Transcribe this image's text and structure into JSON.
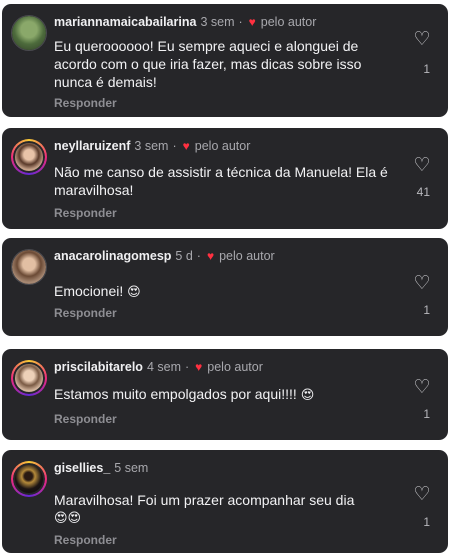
{
  "comments": [
    {
      "user": "mariannamaicabailarina",
      "time": "3 sem",
      "author_tag": "pelo autor",
      "text": "Eu queroooooo! Eu sempre aqueci e alonguei de acordo com o que iria fazer, mas dicas sobre isso nunca é demais!",
      "reply": "Responder",
      "likes": "1",
      "avatar_icon": "profile-photo-plant"
    },
    {
      "user": "neyllaruizenf",
      "time": "3 sem",
      "author_tag": "pelo autor",
      "text": "Não me canso de assistir a técnica da Manuela! Ela é maravilhosa!",
      "reply": "Responder",
      "likes": "41",
      "avatar_icon": "profile-photo-woman"
    },
    {
      "user": "anacarolinagomesp",
      "time": "5 d",
      "author_tag": "pelo autor",
      "text": "Emocionei!",
      "emoji": "😍",
      "reply": "Responder",
      "likes": "1",
      "avatar_icon": "profile-photo-woman"
    },
    {
      "user": "priscilabitarelo",
      "time": "4 sem",
      "author_tag": "pelo autor",
      "text": "Estamos muito empolgados por aqui!!!!",
      "emoji": "😍",
      "reply": "Responder",
      "likes": "1",
      "avatar_icon": "profile-photo-woman"
    },
    {
      "user": "gisellies_",
      "time": "5 sem",
      "text": "Maravilhosa! Foi um prazer acompanhar seu dia",
      "emoji": "😍😍",
      "reply": "Responder",
      "likes": "1",
      "avatar_icon": "profile-photo-dancer"
    }
  ],
  "icons": {
    "like": "heart-outline-icon",
    "author_like": "heart-filled-icon"
  },
  "colors": {
    "card_bg": "#262629",
    "author_heart": "#ff3040",
    "text": "#f2f2f4",
    "muted": "#8e8e93"
  }
}
